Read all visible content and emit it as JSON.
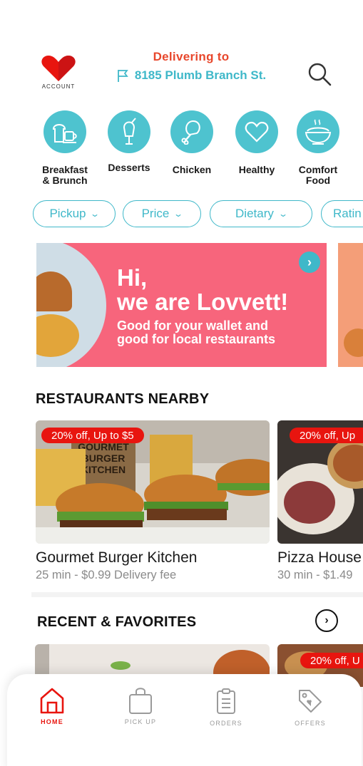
{
  "header": {
    "account_label": "ACCOUNT",
    "delivering_label": "Delivering to",
    "address": "8185 Plumb Branch St."
  },
  "categories": [
    {
      "label_line1": "Breakfast",
      "label_line2": "& Brunch",
      "icon": "bread-coffee-icon"
    },
    {
      "label_line1": "Desserts",
      "label_line2": "",
      "icon": "ice-cream-icon"
    },
    {
      "label_line1": "Chicken",
      "label_line2": "",
      "icon": "chicken-leg-icon"
    },
    {
      "label_line1": "Healthy",
      "label_line2": "",
      "icon": "heart-icon"
    },
    {
      "label_line1": "Comfort",
      "label_line2": "Food",
      "icon": "bowl-icon"
    }
  ],
  "filters": [
    "Pickup",
    "Price",
    "Dietary",
    "Ratin"
  ],
  "banner": {
    "line1": "Hi,",
    "line2": "we are Lovvett!",
    "sub1": "Good for your wallet and",
    "sub2": "good for local restaurants"
  },
  "sections": {
    "nearby": "RESTAURANTS NEARBY",
    "recent": "RECENT & FAVORITES"
  },
  "restaurants": [
    {
      "badge": "20% off, Up to $5",
      "name": "Gourmet Burger Kitchen",
      "meta": "25 min - $0.99 Delivery fee",
      "sign_text": "GOURMET BURGER KITCHEN"
    },
    {
      "badge": "20% off, Up",
      "name": "Pizza House",
      "meta": "30 min - $1.49"
    }
  ],
  "favorites": [
    {
      "badge": ""
    },
    {
      "badge": "20% off, U"
    }
  ],
  "nav": [
    {
      "label": "HOME",
      "icon": "home-icon",
      "active": true
    },
    {
      "label": "PICK UP",
      "icon": "shopping-bag-icon",
      "active": false
    },
    {
      "label": "ORDERS",
      "icon": "clipboard-icon",
      "active": false
    },
    {
      "label": "OFFERS",
      "icon": "tag-icon",
      "active": false
    }
  ],
  "colors": {
    "brand_red": "#e8150f",
    "accent_teal": "#3fb8c9",
    "banner_pink": "#f7657c",
    "delivering_orange": "#e8472c"
  }
}
